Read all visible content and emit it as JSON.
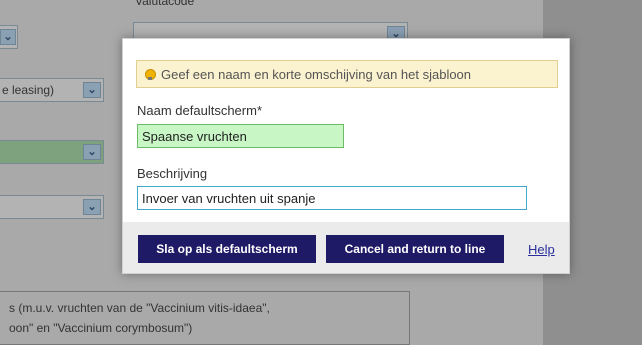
{
  "background": {
    "field_label_top": "Valutacode",
    "select_1_value": "",
    "select_2_value": "e leasing)",
    "select_3_value": "",
    "select_4_value": "",
    "description_line_1": "s (m.u.v. vruchten van de \"Vaccinium vitis-idaea\",",
    "description_line_2": "oon\" en \"Vaccinium corymbosum\")"
  },
  "dialog": {
    "hint_text": "Geef een naam en korte omschijving van het sjabloon",
    "name_label": "Naam defaultscherm*",
    "name_value": "Spaanse vruchten",
    "description_label": "Beschrijving",
    "description_value": "Invoer van vruchten uit spanje",
    "save_button_label": "Sla op als defaultscherm",
    "cancel_button_label": "Cancel and return to line",
    "help_link_label": "Help"
  },
  "colors": {
    "button_background": "#1f1a66",
    "name_field_background": "#c8f7c5",
    "hint_background": "#fbf2cf",
    "overlay": "#a9a9a9"
  },
  "icons": {
    "hint": "lightbulb-icon",
    "dropdown": "chevron-down-icon"
  }
}
